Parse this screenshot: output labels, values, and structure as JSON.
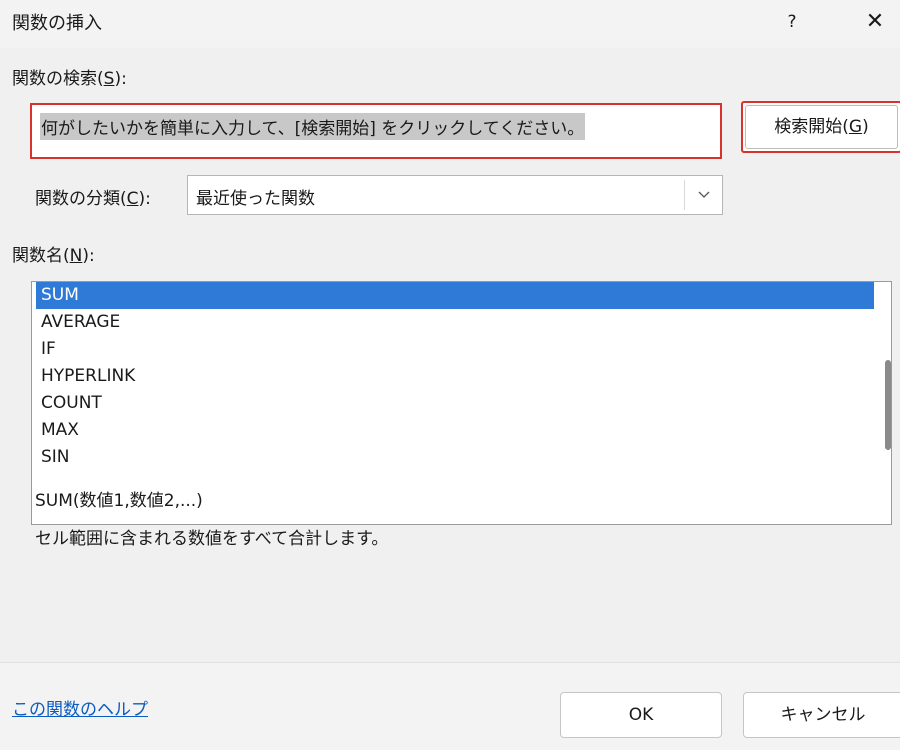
{
  "window": {
    "title": "関数の挿入",
    "help_glyph": "?",
    "close_glyph": "✕"
  },
  "search": {
    "label_prefix": "関数の検索(",
    "label_accel": "S",
    "label_suffix": "):",
    "value": "何がしたいかを簡単に入力して、[検索開始] をクリックしてください。",
    "button_prefix": "検索開始(",
    "button_accel": "G",
    "button_suffix": ")"
  },
  "category": {
    "label_prefix": "関数の分類(",
    "label_accel": "C",
    "label_suffix": "):",
    "selected": "最近使った関数"
  },
  "function_list": {
    "label_prefix": "関数名(",
    "label_accel": "N",
    "label_suffix": "):",
    "items": [
      "SUM",
      "AVERAGE",
      "IF",
      "HYPERLINK",
      "COUNT",
      "MAX",
      "SIN"
    ],
    "selected_index": 0
  },
  "details": {
    "syntax": "SUM(数値1,数値2,...)",
    "description": "セル範囲に含まれる数値をすべて合計します。"
  },
  "footer": {
    "help_link": "この関数のヘルプ",
    "ok": "OK",
    "cancel": "キャンセル"
  },
  "colors": {
    "selection": "#2f7ad6",
    "highlight_border": "#d9312b",
    "link": "#0b5cc0"
  }
}
